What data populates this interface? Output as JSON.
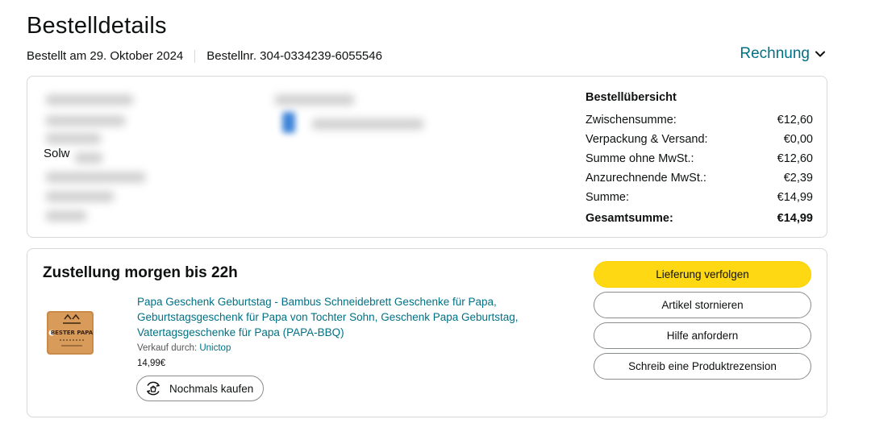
{
  "header": {
    "title": "Bestelldetails",
    "ordered_on": "Bestellt am 29. Oktober 2024",
    "order_number": "Bestellnr. 304-0334239-6055546",
    "invoice_label": "Rechnung"
  },
  "address": {
    "visible_fragment": "Solw"
  },
  "overview": {
    "title": "Bestellübersicht",
    "rows": [
      {
        "label": "Zwischensumme:",
        "value": "€12,60"
      },
      {
        "label": "Verpackung & Versand:",
        "value": "€0,00"
      },
      {
        "label": "Summe ohne MwSt.:",
        "value": "€12,60"
      },
      {
        "label": "Anzurechnende MwSt.:",
        "value": "€2,39"
      },
      {
        "label": "Summe:",
        "value": "€14,99"
      }
    ],
    "total": {
      "label": "Gesamtsumme:",
      "value": "€14,99"
    }
  },
  "delivery": {
    "title": "Zustellung morgen bis 22h",
    "product": {
      "name": "Papa Geschenk Geburtstag - Bambus Schneidebrett Geschenke für Papa, Geburtstagsgeschenk für Papa von Tochter Sohn, Geschenk Papa Geburtstag, Vatertagsgeschenke für Papa (PAPA-BBQ)",
      "sold_by_label": "Verkauf durch:",
      "seller": "Unictop",
      "price": "14,99€",
      "image_text": "BESTER PAPA",
      "buy_again": "Nochmals kaufen"
    },
    "actions": {
      "track": "Lieferung verfolgen",
      "cancel": "Artikel stornieren",
      "help": "Hilfe anfordern",
      "review": "Schreib eine Produktrezension"
    }
  },
  "colors": {
    "link": "#007185",
    "primary_button": "#ffd814",
    "border": "#d5d9d9"
  }
}
